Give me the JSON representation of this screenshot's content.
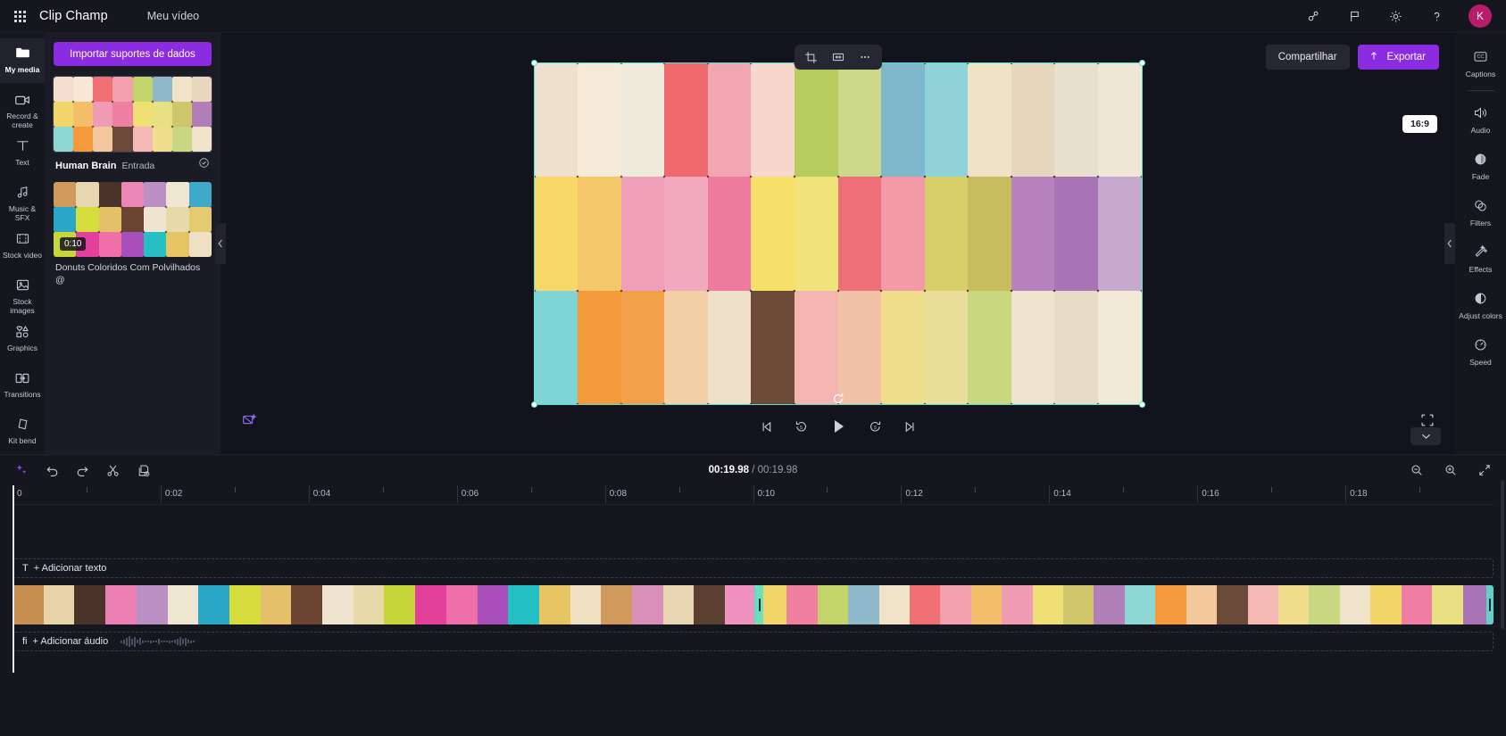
{
  "app": {
    "brand": "Clip Champ",
    "document_title": "Meu vídeo",
    "accent": "#8b2be2",
    "selection_color": "#56e0c8",
    "avatar_initial": "K",
    "avatar_color": "#b81d6b"
  },
  "topbar": {
    "icons": [
      {
        "name": "share-people-icon",
        "label": "Compartilhar pessoas"
      },
      {
        "name": "flag-icon",
        "label": "Comentários"
      },
      {
        "name": "gear-icon",
        "label": "Configurações"
      },
      {
        "name": "help-icon",
        "label": "?"
      }
    ]
  },
  "sidebar": {
    "items": [
      {
        "label": "My media",
        "icon": "folder-icon",
        "active": true
      },
      {
        "label": "Record & create",
        "icon": "camera-icon",
        "active": false
      },
      {
        "label": "Text",
        "icon": "text-icon",
        "active": false
      },
      {
        "label": "Music & SFX",
        "icon": "music-icon",
        "active": false
      },
      {
        "label": "Stock video",
        "icon": "film-icon",
        "active": false
      },
      {
        "label": "Stock images",
        "icon": "image-icon",
        "active": false
      },
      {
        "label": "Graphics",
        "icon": "shapes-icon",
        "active": false
      },
      {
        "label": "Transitions",
        "icon": "transitions-icon",
        "active": false
      },
      {
        "label": "Kit bend",
        "icon": "brandkit-icon",
        "active": false
      }
    ]
  },
  "media_panel": {
    "import_button": "Importar suportes de dados",
    "items": [
      {
        "name": "Human Brain",
        "subtitle": "Entrada",
        "duration": "",
        "selected": true,
        "check_icon": "check-circle-icon"
      },
      {
        "name": "Donuts Coloridos Com Polvilhados @",
        "subtitle": "",
        "duration": "0:10",
        "selected": false,
        "check_icon": ""
      }
    ],
    "collapse_icon": "chevron-left-icon"
  },
  "stage": {
    "tools": [
      {
        "name": "crop-icon",
        "label": "Cortar"
      },
      {
        "name": "fit-frame-icon",
        "label": "Ajustar"
      },
      {
        "name": "more-options-icon",
        "label": "..."
      }
    ],
    "share_button": "Compartilhar",
    "export_button": "Exportar",
    "export_icon": "upload-icon",
    "aspect_ratio": "16:9",
    "collapse_icon": "chevron-left-icon",
    "chevron_down_icon": "chevron-down-icon"
  },
  "transport": {
    "loop_icon": "loop-icon",
    "magic_icon": "magic-cut-icon",
    "controls": [
      {
        "name": "skip-start-button",
        "icon": "skip-start-icon"
      },
      {
        "name": "rewind-5-button",
        "icon": "rewind-5-icon"
      },
      {
        "name": "play-button",
        "icon": "play-icon"
      },
      {
        "name": "forward-5-button",
        "icon": "forward-5-icon"
      },
      {
        "name": "skip-end-button",
        "icon": "skip-end-icon"
      }
    ],
    "fullscreen_icon": "fullscreen-icon"
  },
  "right_sidebar": {
    "items": [
      {
        "label": "Captions",
        "icon": "captions-icon"
      },
      {
        "label": "Audio",
        "icon": "audio-icon"
      },
      {
        "label": "Fade",
        "icon": "fade-icon"
      },
      {
        "label": "Filters",
        "icon": "filters-icon"
      },
      {
        "label": "Effects",
        "icon": "effects-icon"
      },
      {
        "label": "Adjust colors",
        "icon": "adjust-colors-icon"
      },
      {
        "label": "Speed",
        "icon": "speed-icon"
      }
    ]
  },
  "timeline": {
    "tools": [
      {
        "name": "ai-sparkle-button",
        "icon": "sparkle-icon"
      },
      {
        "name": "undo-button",
        "icon": "undo-icon"
      },
      {
        "name": "redo-button",
        "icon": "redo-icon"
      },
      {
        "name": "split-button",
        "icon": "scissors-icon"
      },
      {
        "name": "duplicate-button",
        "icon": "duplicate-icon"
      }
    ],
    "current_time": "00:19.98",
    "separator": "/",
    "total_time": "00:19.98",
    "zoom_out_icon": "zoom-out-icon",
    "zoom_in_icon": "zoom-in-icon",
    "fit_zoom_icon": "fit-timeline-icon",
    "ruler_labels": [
      "0",
      "0:02",
      "0:04",
      "0:06",
      "0:08",
      "0:10",
      "0:12",
      "0:14",
      "0:16",
      "0:18"
    ],
    "tracks": [
      {
        "name": "text-track",
        "label": "+ Adicionar texto",
        "prefix": "T",
        "type": "text"
      },
      {
        "name": "video-track",
        "label": "",
        "prefix": "",
        "type": "video"
      },
      {
        "name": "audio-track",
        "label": "+ Adicionar áudio",
        "prefix": "fi",
        "type": "audio"
      }
    ],
    "clips": [
      {
        "name": "donuts-clip",
        "selected": false,
        "start_pct": 0,
        "width_pct": 50.2
      },
      {
        "name": "macarons-clip",
        "selected": true,
        "start_pct": 50.2,
        "width_pct": 49.8
      }
    ]
  }
}
